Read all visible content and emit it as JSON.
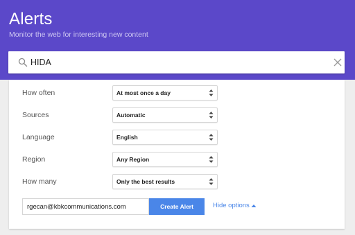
{
  "header": {
    "title": "Alerts",
    "subtitle": "Monitor the web for interesting new content"
  },
  "search": {
    "value": "HIDA",
    "icon": "search-icon",
    "clear_icon": "close-icon"
  },
  "options": [
    {
      "label": "How often",
      "value": "At most once a day"
    },
    {
      "label": "Sources",
      "value": "Automatic"
    },
    {
      "label": "Language",
      "value": "English"
    },
    {
      "label": "Region",
      "value": "Any Region"
    },
    {
      "label": "How many",
      "value": "Only the best results"
    }
  ],
  "delivery": {
    "email": "rgecan@kbkcommunications.com",
    "create_label": "Create Alert",
    "hide_options_label": "Hide options"
  },
  "colors": {
    "header_bg": "#5b48c9",
    "button_bg": "#4a86e8",
    "link": "#4a86e8"
  }
}
